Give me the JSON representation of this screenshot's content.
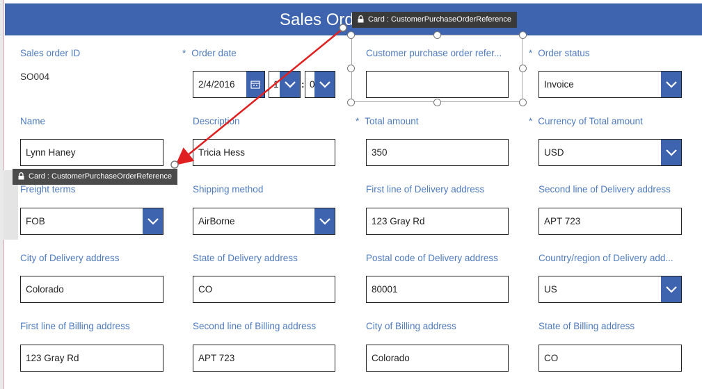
{
  "header": {
    "title": "Sales Order"
  },
  "card_tooltip": {
    "text": "Card : CustomerPurchaseOrderReference"
  },
  "fields": {
    "sales_order_id": {
      "label": "Sales order ID",
      "value": "SO004"
    },
    "order_date": {
      "label": "Order date",
      "required": "*",
      "date": "2/4/2016",
      "hour": "1",
      "minute": "0"
    },
    "customer_po_ref": {
      "label": "Customer purchase order refer...",
      "value": ""
    },
    "order_status": {
      "label": "Order status",
      "required": "*",
      "value": "Invoice"
    },
    "name": {
      "label": "Name",
      "value": "Lynn Haney"
    },
    "description": {
      "label": "Description",
      "value": "Tricia Hess"
    },
    "total_amount": {
      "label": "Total amount",
      "required": "*",
      "value": "350"
    },
    "currency": {
      "label": "Currency of Total amount",
      "required": "*",
      "value": "USD"
    },
    "freight_terms": {
      "label": "Freight terms",
      "value": "FOB"
    },
    "shipping_method": {
      "label": "Shipping method",
      "value": "AirBorne"
    },
    "delivery_line1": {
      "label": "First line of Delivery address",
      "value": "123 Gray Rd"
    },
    "delivery_line2": {
      "label": "Second line of Delivery address",
      "value": "APT 723"
    },
    "delivery_city": {
      "label": "City of Delivery address",
      "value": "Colorado"
    },
    "delivery_state": {
      "label": "State of Delivery address",
      "value": "CO"
    },
    "delivery_postal": {
      "label": "Postal code of Delivery address",
      "value": "80001"
    },
    "delivery_country": {
      "label": "Country/region of Delivery add...",
      "value": "US"
    },
    "billing_line1": {
      "label": "First line of Billing address",
      "value": "123 Gray Rd"
    },
    "billing_line2": {
      "label": "Second line of Billing address",
      "value": "APT 723"
    },
    "billing_city": {
      "label": "City of Billing address",
      "value": "Colorado"
    },
    "billing_state": {
      "label": "State of Billing address",
      "value": "CO"
    }
  },
  "colors": {
    "accent": "#3e64b0",
    "label": "#4f7bbf",
    "arrow": "#e02020"
  },
  "icons": {
    "calendar": "calendar-icon",
    "dropdown": "chevron-down-icon",
    "lock": "lock-icon"
  }
}
